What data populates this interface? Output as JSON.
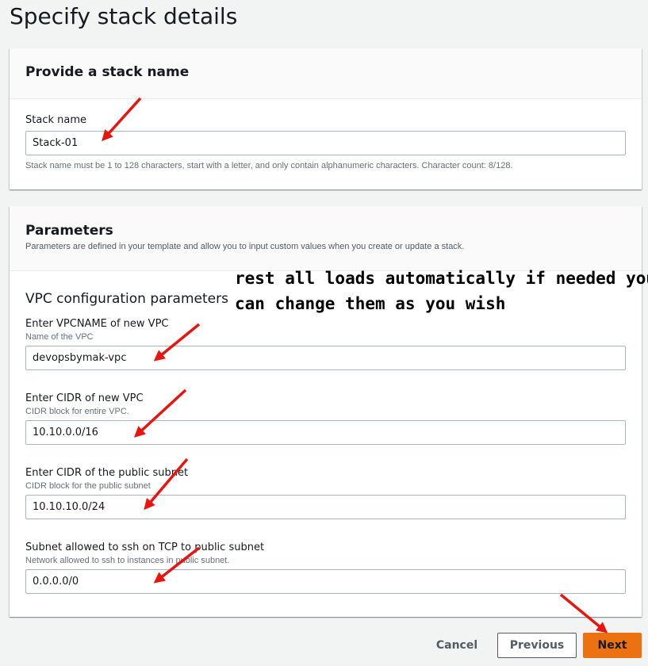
{
  "page": {
    "title": "Specify stack details"
  },
  "stack_name_panel": {
    "heading": "Provide a stack name",
    "field_label": "Stack name",
    "value": "Stack-01",
    "help_text": "Stack name must be 1 to 128 characters, start with a letter, and only contain alphanumeric characters. Character count: 8/128."
  },
  "parameters_panel": {
    "heading": "Parameters",
    "description": "Parameters are defined in your template and allow you to input custom values when you create or update a stack.",
    "section_title": "VPC configuration parameters",
    "fields": [
      {
        "label": "Enter VPCNAME of new VPC",
        "hint": "Name of the VPC",
        "value": "devopsbymak-vpc"
      },
      {
        "label": "Enter CIDR of new VPC",
        "hint": "CIDR block for entire VPC.",
        "value": "10.10.0.0/16"
      },
      {
        "label": "Enter CIDR of the public subnet",
        "hint": "CIDR block for the public subnet",
        "value": "10.10.10.0/24"
      },
      {
        "label": "Subnet allowed to ssh on TCP to public subnet",
        "hint": "Network allowed to ssh to instances in public subnet.",
        "value": "0.0.0.0/0"
      }
    ]
  },
  "annotation": {
    "line1": "rest all loads automatically if needed you",
    "line2": "can change them as you wish",
    "arrow_color": "#e8150f"
  },
  "footer": {
    "cancel_label": "Cancel",
    "previous_label": "Previous",
    "next_label": "Next"
  },
  "colors": {
    "primary_button": "#ec7211",
    "background": "#f2f3f3"
  }
}
